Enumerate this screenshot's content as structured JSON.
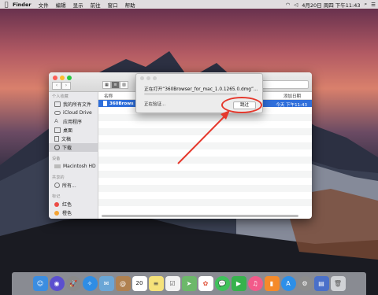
{
  "menubar": {
    "apple": "",
    "items": [
      "Finder",
      "文件",
      "编辑",
      "显示",
      "前往",
      "窗口",
      "帮助"
    ],
    "clock": "4月20日 周四 下午11:43"
  },
  "finder": {
    "nav_back": "‹",
    "nav_forward": "›",
    "sidebar": {
      "section_personal": "个人收藏",
      "personal": [
        "我的所有文件",
        "iCloud Drive",
        "应用程序",
        "桌面",
        "文稿",
        "下载"
      ],
      "section_devices": "设备",
      "devices": [
        "Macintosh HD"
      ],
      "section_shared": "共享的",
      "shared": [
        "所有..."
      ],
      "section_tags": "标记",
      "tags": [
        {
          "label": "红色",
          "color": "#ec4b45"
        },
        {
          "label": "橙色",
          "color": "#f3a233"
        }
      ]
    },
    "columns": {
      "name": "名称",
      "date_added": "添加日期"
    },
    "selected_file": {
      "name": "360Brows",
      "date": "今天 下午11:43"
    }
  },
  "dialog": {
    "title": "正在打开“360Browser_for_mac_1.0.1265.0.dmg”...",
    "status": "正在验证...",
    "skip_label": "跳过"
  },
  "colors": {
    "annotation": "#e5382c",
    "selection": "#2f6fdb"
  },
  "dock_icons": [
    "finder-icon",
    "siri-icon",
    "launchpad-icon",
    "safari-icon",
    "mail-icon",
    "contacts-icon",
    "calendar-icon",
    "notes-icon",
    "reminders-icon",
    "maps-icon",
    "photos-icon",
    "messages-icon",
    "facetime-icon",
    "itunes-icon",
    "ibooks-icon",
    "appstore-icon",
    "preferences-icon",
    "documents-icon",
    "trash-icon"
  ],
  "calendar_day": "20"
}
